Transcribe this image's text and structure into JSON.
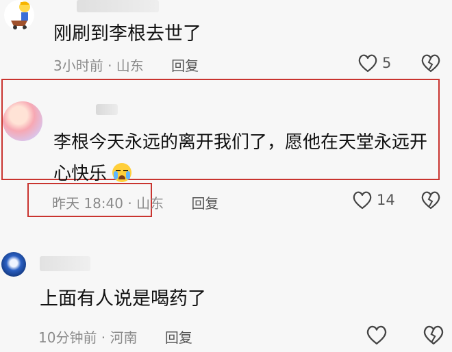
{
  "comments": [
    {
      "text": "刚刷到李根去世了",
      "time_location": "3小时前 · 山东",
      "reply_label": "回复",
      "likes": "5"
    },
    {
      "text_line1": "李根今天永远的离开我们了，愿他在天堂永远开",
      "text_line2": "心快乐",
      "time_location": "昨天 18:40 · 山东",
      "reply_label": "回复",
      "likes": "14"
    },
    {
      "text": "上面有人说是喝药了",
      "time_location": "10分钟前 · 河南",
      "reply_label": "回复",
      "likes": ""
    }
  ],
  "colors": {
    "highlight_box": "#c9342f",
    "meta_text": "#8a8a8a",
    "background": "#f7f7f7"
  },
  "icons": [
    "heart-outline-icon",
    "broken-heart-icon",
    "crying-face-emoji"
  ]
}
